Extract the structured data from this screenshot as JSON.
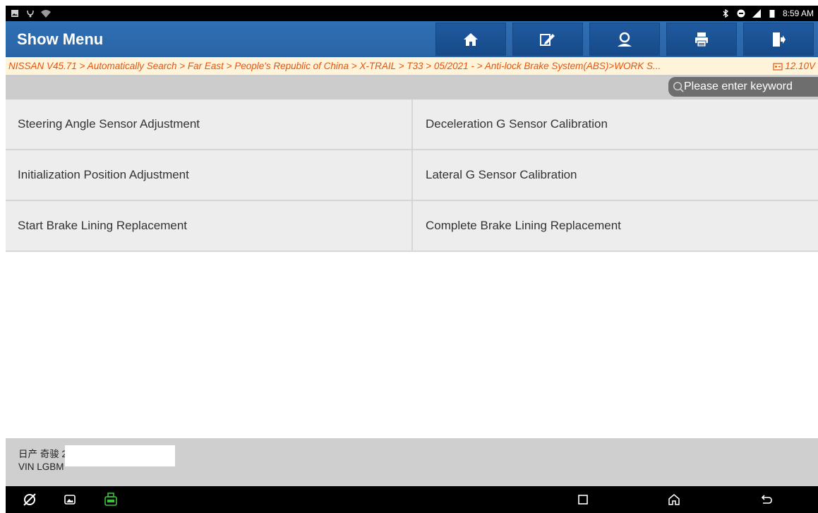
{
  "status": {
    "time": "8:59 AM"
  },
  "header": {
    "title": "Show Menu",
    "buttons": [
      "home",
      "edit",
      "user",
      "print",
      "exit"
    ]
  },
  "breadcrumb": {
    "path": "NISSAN V45.71 > Automatically Search > Far East > People's Republic of China > X-TRAIL > T33 > 05/2021 - > Anti-lock Brake System(ABS)>WORK S...",
    "voltage": "12.10V"
  },
  "search": {
    "placeholder": "Please enter keyword"
  },
  "menu": {
    "items": [
      "Steering Angle Sensor Adjustment",
      "Deceleration G Sensor Calibration",
      "Initialization Position Adjustment",
      "Lateral G Sensor Calibration",
      "Start Brake Lining Replacement",
      "Complete Brake Lining Replacement"
    ]
  },
  "footer": {
    "vehicle": "日产 奇骏 2021",
    "vin": "VIN LGBM"
  },
  "colors": {
    "header": "#2b6cb0",
    "breadcrumb_text": "#e8540e",
    "breadcrumb_bg": "#fff4da",
    "vci_icon": "#3cc13c"
  }
}
